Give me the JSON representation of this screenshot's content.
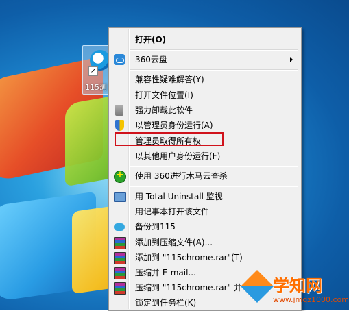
{
  "desktop": {
    "icon_caption": "115浏"
  },
  "menu": {
    "items": [
      {
        "label": "打开(O)",
        "icon": "none",
        "bold": true
      },
      {
        "label": "360云盘",
        "icon": "360-cloud-icon",
        "submenu": true
      },
      {
        "label": "兼容性疑难解答(Y)",
        "icon": "none"
      },
      {
        "label": "打开文件位置(I)",
        "icon": "none"
      },
      {
        "label": "强力卸载此软件",
        "icon": "trash-icon"
      },
      {
        "label": "以管理员身份运行(A)",
        "icon": "shield-icon"
      },
      {
        "label": "管理员取得所有权",
        "icon": "none",
        "highlighted": true
      },
      {
        "label": "以其他用户身份运行(F)",
        "icon": "none"
      },
      {
        "label": "使用 360进行木马云查杀",
        "icon": "360-scan-icon"
      },
      {
        "label": "用 Total Uninstall 监视",
        "icon": "monitor-icon"
      },
      {
        "label": "用记事本打开该文件",
        "icon": "none"
      },
      {
        "label": "备份到115",
        "icon": "cloud-icon"
      },
      {
        "label": "添加到压缩文件(A)...",
        "icon": "rar-icon"
      },
      {
        "label": "添加到 \"115chrome.rar\"(T)",
        "icon": "rar-icon"
      },
      {
        "label": "压缩并 E-mail...",
        "icon": "rar-icon"
      },
      {
        "label": "压缩到 \"115chrome.rar\" 并 E-mail",
        "icon": "rar-icon"
      },
      {
        "label": "锁定到任务栏(K)",
        "icon": "none"
      }
    ]
  },
  "watermark": {
    "title": "学知网",
    "url": "www.jmqz1000.com"
  },
  "colors": {
    "highlight_border": "#d0121b",
    "menu_bg": "#f0f0f0"
  }
}
